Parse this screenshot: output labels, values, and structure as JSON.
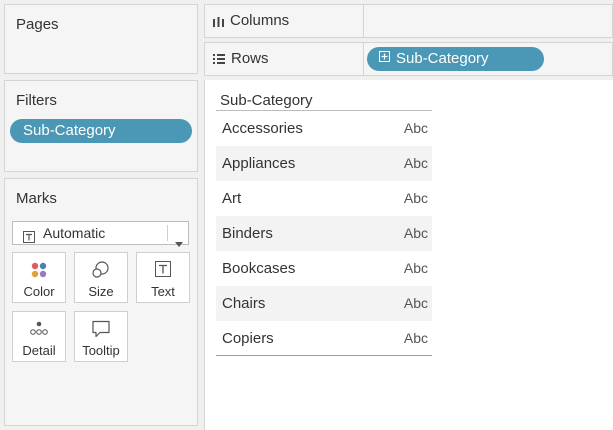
{
  "pages": {
    "title": "Pages"
  },
  "filters": {
    "title": "Filters",
    "pills": [
      "Sub-Category"
    ]
  },
  "marks": {
    "title": "Marks",
    "mark_type": "Automatic",
    "buttons": [
      {
        "label": "Color",
        "icon": "color-icon"
      },
      {
        "label": "Size",
        "icon": "size-icon"
      },
      {
        "label": "Text",
        "icon": "text-icon"
      },
      {
        "label": "Detail",
        "icon": "detail-icon"
      },
      {
        "label": "Tooltip",
        "icon": "tooltip-icon"
      }
    ]
  },
  "shelves": {
    "columns": {
      "label": "Columns",
      "icon": "columns-icon"
    },
    "rows": {
      "label": "Rows",
      "icon": "rows-icon",
      "pills": [
        "Sub-Category"
      ]
    }
  },
  "view": {
    "header": "Sub-Category",
    "rows": [
      {
        "name": "Accessories",
        "value": "Abc"
      },
      {
        "name": "Appliances",
        "value": "Abc"
      },
      {
        "name": "Art",
        "value": "Abc"
      },
      {
        "name": "Binders",
        "value": "Abc"
      },
      {
        "name": "Bookcases",
        "value": "Abc"
      },
      {
        "name": "Chairs",
        "value": "Abc"
      },
      {
        "name": "Copiers",
        "value": "Abc"
      }
    ]
  },
  "colors": {
    "pill": "#4a98b5",
    "panel": "#f5f5f5",
    "border": "#d4d4d4"
  }
}
